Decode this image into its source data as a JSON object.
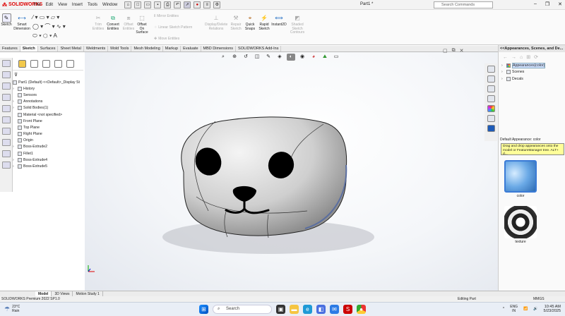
{
  "app": {
    "logo_text": "SOLIDWORKS",
    "menus": [
      "File",
      "Edit",
      "View",
      "Insert",
      "Tools",
      "Window"
    ],
    "doc_title": "Part1 *",
    "search_placeholder": "Search Commands"
  },
  "ribbon": {
    "sketch": "Sketch",
    "smart_dimension": "Smart Dimension",
    "trim_entities": "Trim Entities",
    "convert_entities": "Convert Entities",
    "offset_entities": "Offset Entities",
    "offset_on_surface": "Offset On Surface",
    "mirror_entities": "Mirror Entities",
    "linear_sketch_pattern": "Linear Sketch Pattern",
    "move_entities": "Move Entities",
    "display_delete_relations": "Display/Delete Relations",
    "repair_sketch": "Repair Sketch",
    "quick_snaps": "Quick Snaps",
    "rapid_sketch": "Rapid Sketch",
    "instant2d": "Instant2D",
    "shaded_sketch_contours": "Shaded Sketch Contours"
  },
  "cmd_tabs": [
    "Features",
    "Sketch",
    "Surfaces",
    "Sheet Metal",
    "Weldments",
    "Mold Tools",
    "Mesh Modeling",
    "Markup",
    "Evaluate",
    "MBD Dimensions",
    "SOLIDWORKS Add-Ins"
  ],
  "active_cmd_tab": "Sketch",
  "feature_tree": {
    "part": "Part1 (Default) <<Default>_Display St",
    "items": [
      {
        "label": "History",
        "expand": "›"
      },
      {
        "label": "Sensors",
        "expand": ""
      },
      {
        "label": "Annotations",
        "expand": "›"
      },
      {
        "label": "Solid Bodies(1)",
        "expand": "›"
      },
      {
        "label": "Material <not specified>",
        "expand": ""
      },
      {
        "label": "Front Plane",
        "expand": ""
      },
      {
        "label": "Top Plane",
        "expand": ""
      },
      {
        "label": "Right Plane",
        "expand": ""
      },
      {
        "label": "Origin",
        "expand": ""
      },
      {
        "label": "Boss-Extrude2",
        "expand": "›"
      },
      {
        "label": "Fillet1",
        "expand": ""
      },
      {
        "label": "Boss-Extrude4",
        "expand": "›"
      },
      {
        "label": "Boss-Extrude5",
        "expand": "›"
      }
    ]
  },
  "right_panel": {
    "title": "<<Appearances, Scenes, and De...",
    "tree": [
      "Appearances(color)",
      "Scenes",
      "Decals"
    ],
    "default_label": "Default Appearance: color",
    "tooltip": "Drag and drop appearances onto the model or FeatureManager tree.  ALT+ d...",
    "swatch1": "color",
    "swatch2": "texture"
  },
  "bottom_tabs": [
    "Model",
    "3D Views",
    "Motion Study 1"
  ],
  "active_bottom_tab": "Model",
  "status": {
    "left": "SOLIDWORKS Premium 2022 SP1.0",
    "editing": "Editing Part",
    "units": "MMGS"
  },
  "taskbar": {
    "temp": "23°C",
    "weather": "Rain",
    "search": "Search",
    "lang1": "ENG",
    "lang2": "IN",
    "time": "10:45 AM",
    "date": "5/23/2025"
  },
  "colors": {
    "accent": "#0078d7",
    "brand_red": "#d00000",
    "tooltip_bg": "#ffff99"
  }
}
